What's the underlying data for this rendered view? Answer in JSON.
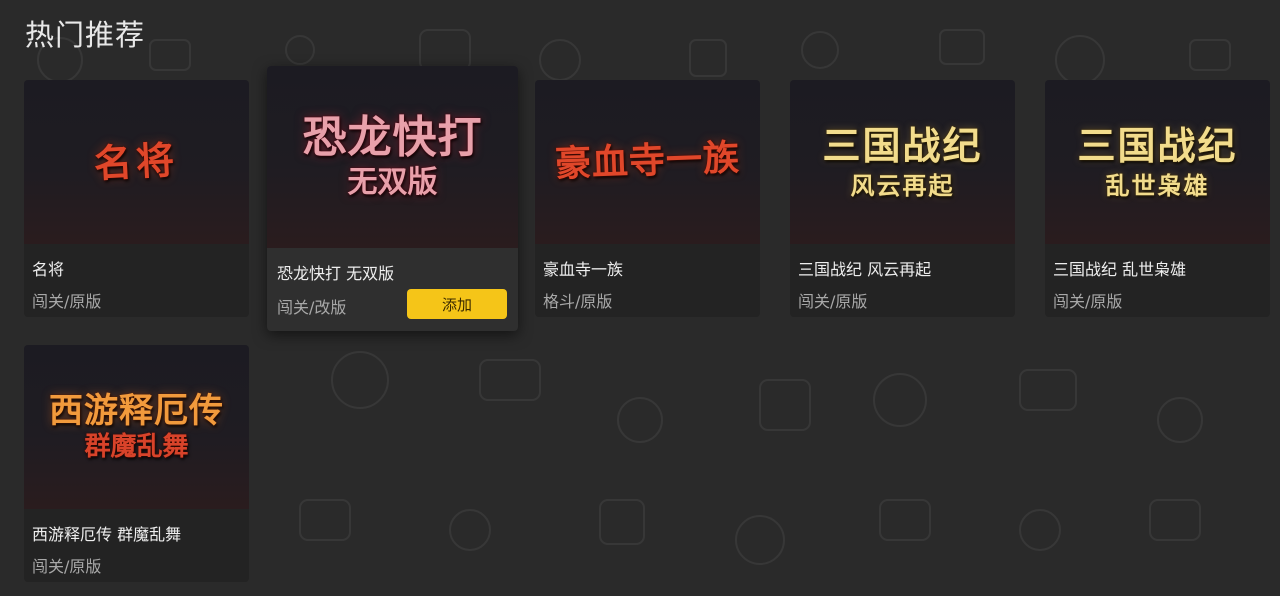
{
  "section": {
    "title": "热门推荐"
  },
  "actions": {
    "add_label": "添加"
  },
  "games": [
    {
      "name": "名将",
      "tag": "闯关/原版",
      "logo_line1": "名将",
      "logo_line2": "",
      "logo_color": "#e0472a"
    },
    {
      "name": "恐龙快打 无双版",
      "tag": "闯关/改版",
      "logo_line1": "恐龙快打",
      "logo_line2": "无双版",
      "logo_color": "#e8a0aa"
    },
    {
      "name": "豪血寺一族",
      "tag": "格斗/原版",
      "logo_line1": "豪血寺一族",
      "logo_line2": "",
      "logo_color": "#e0472a"
    },
    {
      "name": "三国战纪 风云再起",
      "tag": "闯关/原版",
      "logo_line1": "三国战纪",
      "logo_line2": "风云再起",
      "logo_color": "#f2dc8c"
    },
    {
      "name": "三国战纪 乱世枭雄",
      "tag": "闯关/原版",
      "logo_line1": "三国战纪",
      "logo_line2": "乱世枭雄",
      "logo_color": "#f2dc8c"
    },
    {
      "name": "西游释厄传 群魔乱舞",
      "tag": "闯关/原版",
      "logo_line1": "西游释厄传",
      "logo_line2": "群魔乱舞",
      "logo_color": "#f19a3c"
    }
  ]
}
